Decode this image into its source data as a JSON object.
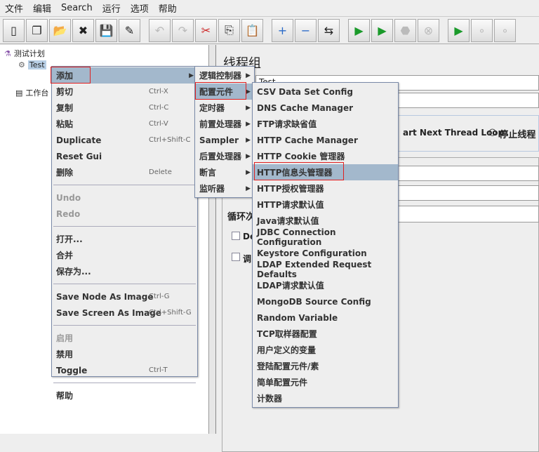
{
  "menubar": [
    "文件",
    "编辑",
    "Search",
    "运行",
    "选项",
    "帮助"
  ],
  "toolbar": [
    {
      "icon": "new-icon"
    },
    {
      "icon": "templates-icon"
    },
    {
      "icon": "open-icon"
    },
    {
      "icon": "close-icon"
    },
    {
      "icon": "save-icon"
    },
    {
      "icon": "save-as-icon"
    },
    {
      "gap": true
    },
    {
      "icon": "undo-icon"
    },
    {
      "icon": "redo-icon"
    },
    {
      "icon": "cut-icon"
    },
    {
      "icon": "copy-icon"
    },
    {
      "icon": "paste-icon"
    },
    {
      "gap": true
    },
    {
      "icon": "expand-icon"
    },
    {
      "icon": "collapse-icon"
    },
    {
      "icon": "toggle-icon"
    },
    {
      "gap": true
    },
    {
      "icon": "start-icon"
    },
    {
      "icon": "start-no-timers-icon"
    },
    {
      "icon": "stop-icon"
    },
    {
      "icon": "shutdown-icon"
    },
    {
      "gap": true
    },
    {
      "icon": "remote-start-icon"
    },
    {
      "icon": "remote-stop-icon"
    },
    {
      "icon": "remote-shutdown-icon"
    }
  ],
  "tree": {
    "plan": "测试计划",
    "thread_group": "Test",
    "workbench": "工作台"
  },
  "panel": {
    "title": "线程组",
    "name_value": "Test",
    "radio_partial": "art Next Thread Loop",
    "radio_stop": "停止线程",
    "loop_label": "循环次",
    "checkbox1": "De",
    "checkbox2": "调"
  },
  "context_menu": [
    {
      "label": "添加",
      "arrow": true,
      "hl": true
    },
    {
      "label": "剪切",
      "sc": "Ctrl-X"
    },
    {
      "label": "复制",
      "sc": "Ctrl-C"
    },
    {
      "label": "粘贴",
      "sc": "Ctrl-V"
    },
    {
      "label": "Duplicate",
      "sc": "Ctrl+Shift-C"
    },
    {
      "label": "Reset Gui"
    },
    {
      "label": "删除",
      "sc": "Delete"
    },
    {
      "sep": true
    },
    {
      "label": "Undo",
      "dis": true
    },
    {
      "label": "Redo",
      "dis": true
    },
    {
      "sep": true
    },
    {
      "label": "打开..."
    },
    {
      "label": "合并"
    },
    {
      "label": "保存为..."
    },
    {
      "sep": true
    },
    {
      "label": "Save Node As Image",
      "sc": "Ctrl-G"
    },
    {
      "label": "Save Screen As Image",
      "sc": "Ctrl+Shift-G"
    },
    {
      "sep": true
    },
    {
      "label": "启用",
      "dis": true
    },
    {
      "label": "禁用"
    },
    {
      "label": "Toggle",
      "sc": "Ctrl-T"
    },
    {
      "sep": true
    },
    {
      "label": "帮助"
    }
  ],
  "add_menu": [
    {
      "label": "逻辑控制器"
    },
    {
      "label": "配置元件",
      "hl": true
    },
    {
      "label": "定时器"
    },
    {
      "label": "前置处理器"
    },
    {
      "label": "Sampler"
    },
    {
      "label": "后置处理器"
    },
    {
      "label": "断言"
    },
    {
      "label": "监听器"
    }
  ],
  "config_menu": [
    "CSV Data Set Config",
    "DNS Cache Manager",
    "FTP请求缺省值",
    "HTTP Cache Manager",
    "HTTP Cookie 管理器",
    "HTTP信息头管理器",
    "HTTP授权管理器",
    "HTTP请求默认值",
    "Java请求默认值",
    "JDBC Connection Configuration",
    "Keystore Configuration",
    "LDAP Extended Request Defaults",
    "LDAP请求默认值",
    "MongoDB Source Config",
    "Random Variable",
    "TCP取样器配置",
    "用户定义的变量",
    "登陆配置元件/素",
    "简单配置元件",
    "计数器"
  ],
  "config_selected": "HTTP信息头管理器",
  "colors": {
    "highlight": "#a3b8cc",
    "annotation": "#e02020"
  }
}
